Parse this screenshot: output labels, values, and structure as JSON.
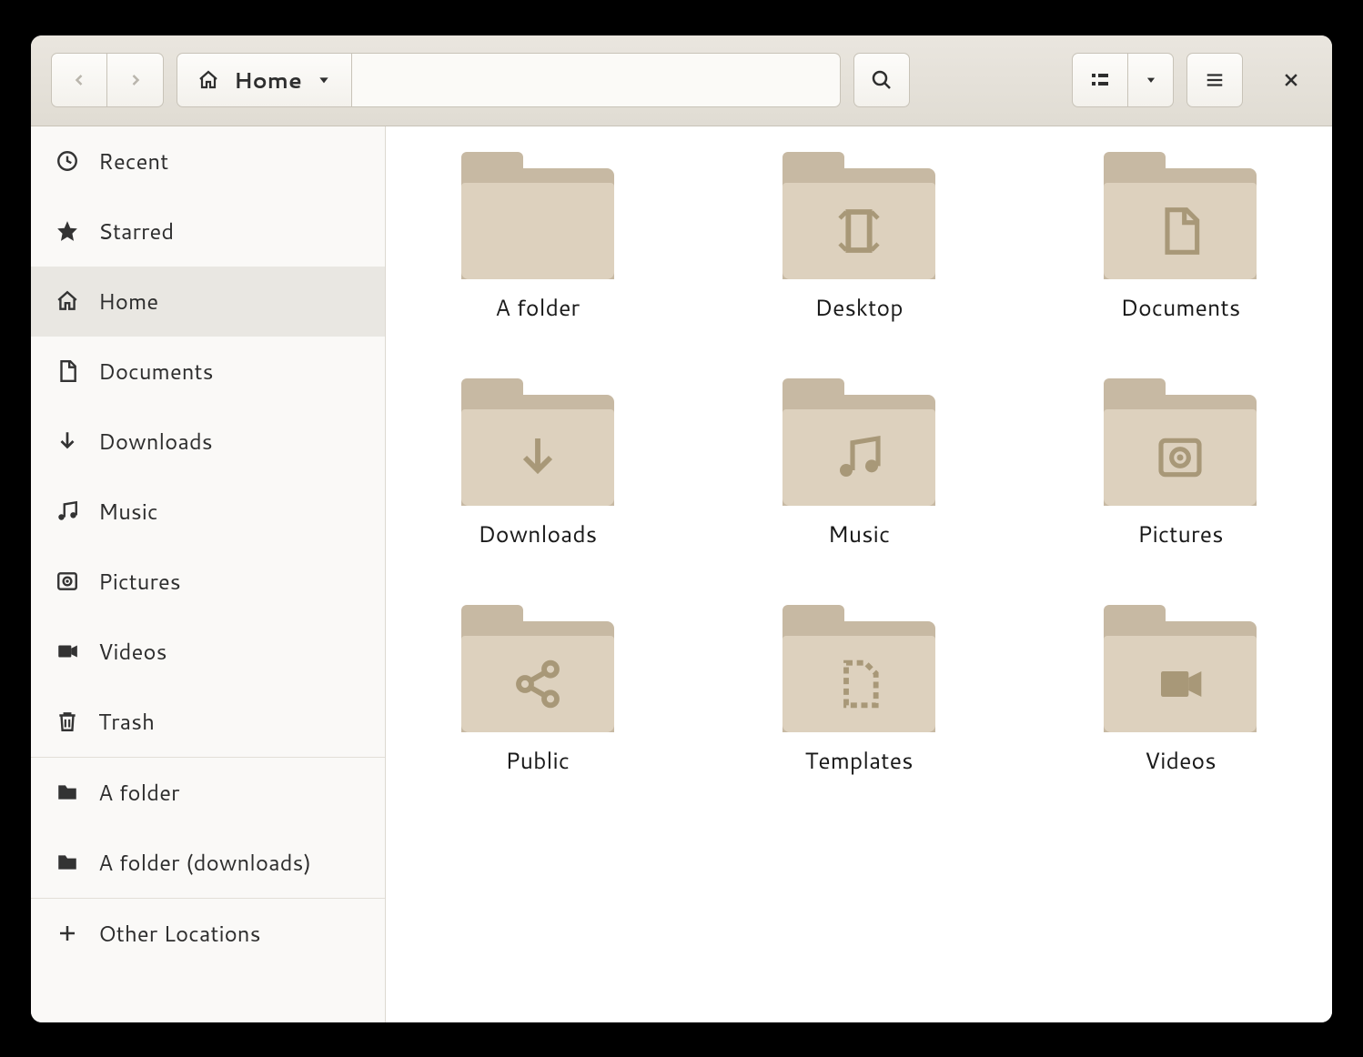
{
  "path": {
    "location": "Home"
  },
  "sidebar": {
    "items": [
      {
        "label": "Recent",
        "icon": "clock"
      },
      {
        "label": "Starred",
        "icon": "star"
      },
      {
        "label": "Home",
        "icon": "home",
        "selected": true
      },
      {
        "label": "Documents",
        "icon": "document"
      },
      {
        "label": "Downloads",
        "icon": "download"
      },
      {
        "label": "Music",
        "icon": "music"
      },
      {
        "label": "Pictures",
        "icon": "pictures"
      },
      {
        "label": "Videos",
        "icon": "videos"
      },
      {
        "label": "Trash",
        "icon": "trash"
      }
    ],
    "bookmarks": [
      {
        "label": "A folder",
        "icon": "folder"
      },
      {
        "label": "A folder (downloads)",
        "icon": "folder"
      }
    ],
    "other": {
      "label": "Other Locations",
      "icon": "plus"
    }
  },
  "folders": [
    {
      "label": "A folder",
      "glyph": ""
    },
    {
      "label": "Desktop",
      "glyph": "desktop"
    },
    {
      "label": "Documents",
      "glyph": "document"
    },
    {
      "label": "Downloads",
      "glyph": "download"
    },
    {
      "label": "Music",
      "glyph": "music"
    },
    {
      "label": "Pictures",
      "glyph": "pictures"
    },
    {
      "label": "Public",
      "glyph": "share"
    },
    {
      "label": "Templates",
      "glyph": "template"
    },
    {
      "label": "Videos",
      "glyph": "videos"
    }
  ],
  "colors": {
    "folder_front": "#ddd1be",
    "folder_back": "#c7b9a3",
    "glyph": "#a89878"
  }
}
